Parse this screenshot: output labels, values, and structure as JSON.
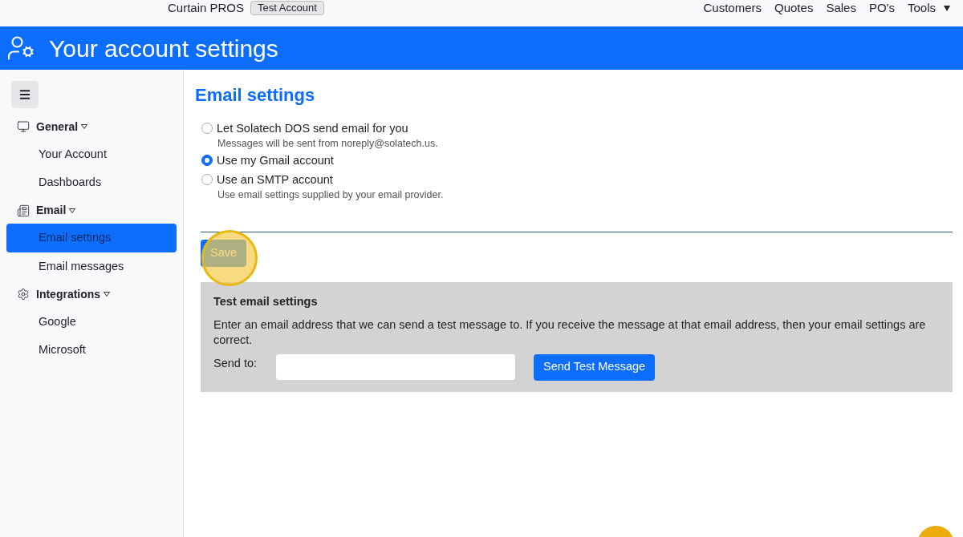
{
  "topbar": {
    "company": "Curtain PROS",
    "badge": "Test Account",
    "nav": [
      {
        "label": "Customers",
        "dropdown": false
      },
      {
        "label": "Quotes",
        "dropdown": false
      },
      {
        "label": "Sales",
        "dropdown": false
      },
      {
        "label": "PO's",
        "dropdown": false
      },
      {
        "label": "Tools",
        "dropdown": true
      }
    ]
  },
  "header": {
    "title": "Your account settings"
  },
  "sidebar": {
    "groups": [
      {
        "label": "General",
        "items": [
          {
            "label": "Your Account",
            "selected": false
          },
          {
            "label": "Dashboards",
            "selected": false
          }
        ]
      },
      {
        "label": "Email",
        "items": [
          {
            "label": "Email settings",
            "selected": true
          },
          {
            "label": "Email messages",
            "selected": false
          }
        ]
      },
      {
        "label": "Integrations",
        "items": [
          {
            "label": "Google",
            "selected": false
          },
          {
            "label": "Microsoft",
            "selected": false
          }
        ]
      }
    ]
  },
  "content": {
    "title": "Email settings",
    "options": [
      {
        "label": "Let Solatech DOS send email for you",
        "hint": "Messages will be sent from noreply@solatech.us.",
        "selected": false
      },
      {
        "label": "Use my Gmail account",
        "selected": true
      },
      {
        "label": "Use an SMTP account",
        "hint": "Use email settings supplied by your email provider.",
        "selected": false
      }
    ],
    "save": "Save",
    "test": {
      "title": "Test email settings",
      "text": "Enter an email address that we can send a test message to. If you receive the message at that email address, then your email settings are correct.",
      "send_label": "Send to:",
      "button": "Send Test Message"
    }
  }
}
